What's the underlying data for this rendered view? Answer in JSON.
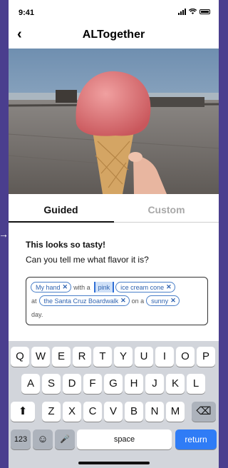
{
  "status_bar": {
    "time": "9:41"
  },
  "nav": {
    "back_glyph": "‹",
    "title": "ALTogether"
  },
  "photo": {
    "alt": "Hand holding a pink ice cream cone on the Santa Cruz Boardwalk"
  },
  "tabs": [
    {
      "label": "Guided",
      "active": true
    },
    {
      "label": "Custom",
      "active": false
    }
  ],
  "prompt": {
    "line1": "This looks so tasty!",
    "line2": "Can you tell me what flavor it is?"
  },
  "answer": {
    "chip1": "My hand",
    "word_with": "with a",
    "selected": "pink",
    "chip2": "ice cream cone",
    "word_at": "at",
    "chip3": "the Santa Cruz Boardwalk",
    "word_on": "on a",
    "chip4": "sunny",
    "word_day": "day.",
    "remove_glyph": "✕"
  },
  "keyboard": {
    "row1": [
      "Q",
      "W",
      "E",
      "R",
      "T",
      "Y",
      "U",
      "I",
      "O",
      "P"
    ],
    "row2": [
      "A",
      "S",
      "D",
      "F",
      "G",
      "H",
      "J",
      "K",
      "L"
    ],
    "row3": [
      "Z",
      "X",
      "C",
      "V",
      "B",
      "N",
      "M"
    ],
    "shift": "⬆",
    "delete": "⌫",
    "numbers": "123",
    "emoji": "☺",
    "mic": "🎤",
    "space": "space",
    "return": "return"
  },
  "colors": {
    "accent": "#2f7cf6",
    "chip_border": "#4a7fc8",
    "frame": "#4a3e8e"
  }
}
